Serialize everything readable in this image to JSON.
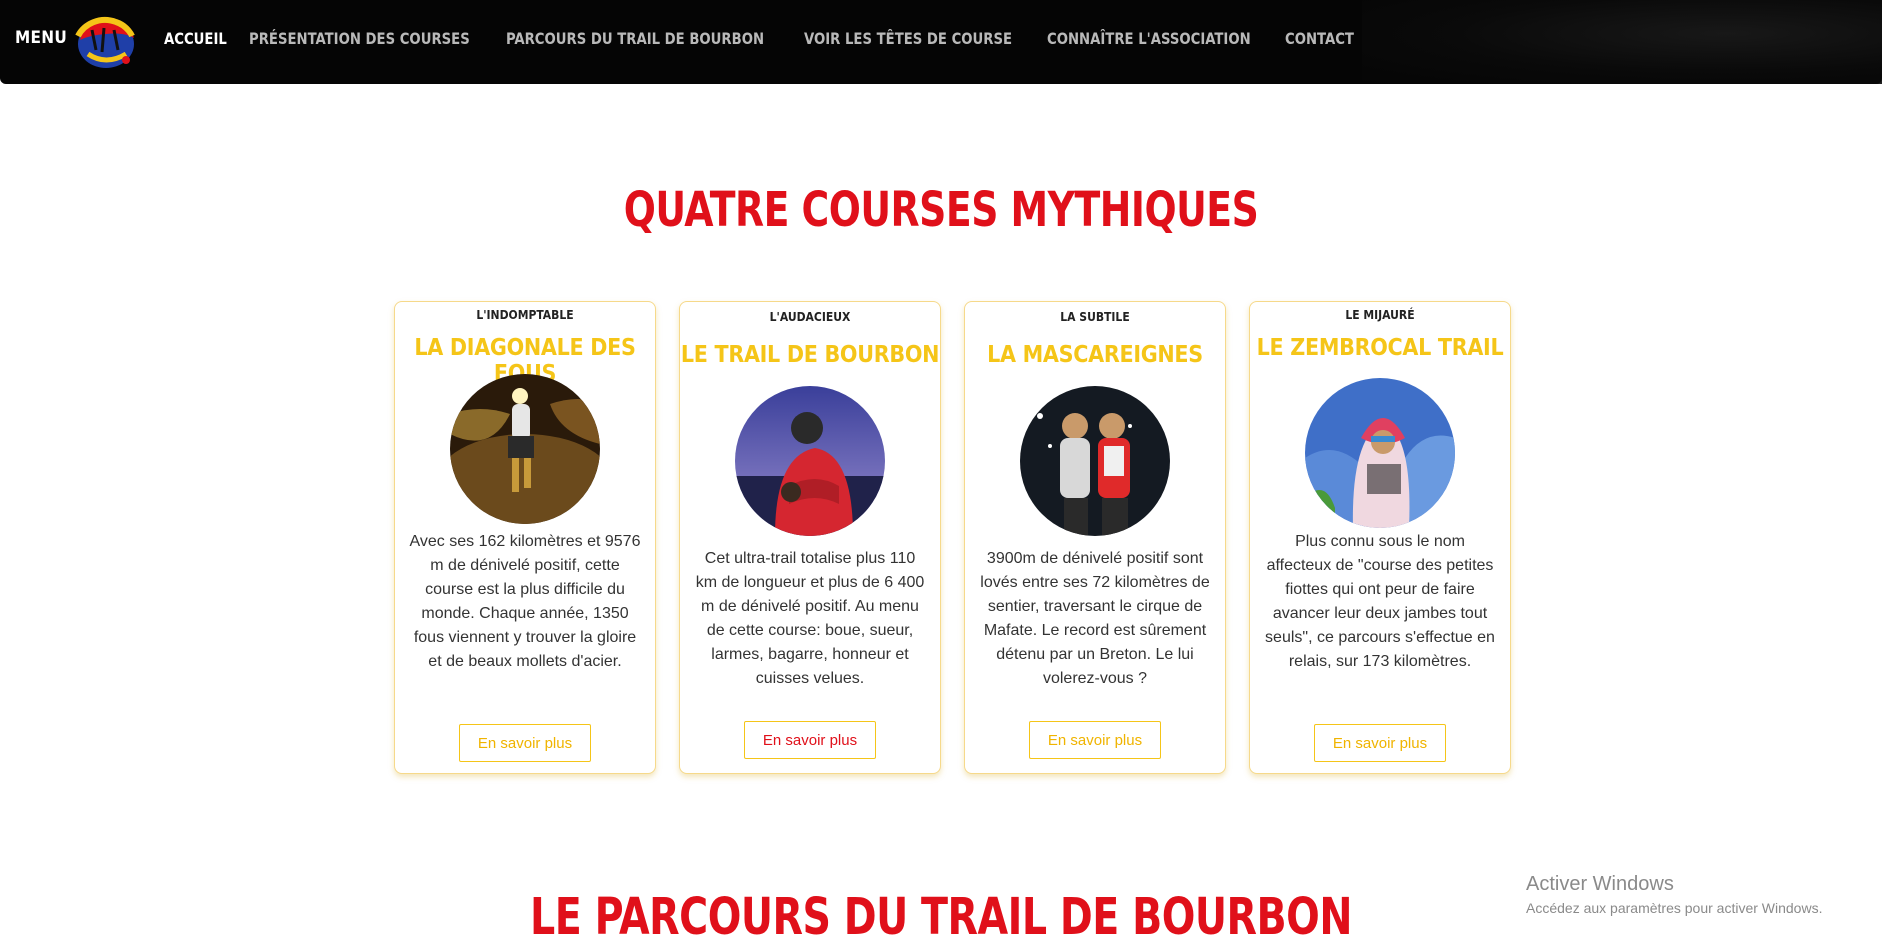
{
  "navbar": {
    "menu_label": "MENU",
    "links": [
      {
        "label": "ACCUEIL",
        "active": true
      },
      {
        "label": "PRÉSENTATION DES COURSES",
        "active": false
      },
      {
        "label": "PARCOURS DU TRAIL DE BOURBON",
        "active": false
      },
      {
        "label": "VOIR LES TÊTES DE COURSE",
        "active": false
      },
      {
        "label": "CONNAÎTRE L'ASSOCIATION",
        "active": false
      },
      {
        "label": "CONTACT",
        "active": false
      }
    ]
  },
  "section1": {
    "title": "QUATRE COURSES MYTHIQUES"
  },
  "cards": [
    {
      "kicker": "L'INDOMPTABLE",
      "name": "LA DIAGONALE DES FOUS",
      "desc": "Avec ses 162 kilomètres et 9576 m de dénivelé positif, cette course est la plus difficile du monde. Chaque année, 1350 fous viennent y trouver la gloire et de beaux mollets d'acier.",
      "button": "En savoir plus",
      "photo_icon": "night-trail-runner-photo"
    },
    {
      "kicker": "L'AUDACIEUX",
      "name": "LE TRAIL DE BOURBON",
      "desc": "Cet ultra-trail totalise plus 110 km de longueur et plus de 6 400 m de dénivelé positif. Au menu de cette course: boue, sueur, larmes, bagarre, honneur et cuisses velues.",
      "button": "En savoir plus",
      "photo_icon": "runners-hug-photo"
    },
    {
      "kicker": "LA SUBTILE",
      "name": "LA MASCAREIGNES",
      "desc": "3900m de dénivelé positif sont lovés entre ses 72 kilomètres de sentier, traversant le cirque de Mafate. Le record est sûrement détenu par un Breton. Le lui volerez-vous ?",
      "button": "En savoir plus",
      "photo_icon": "two-runners-photo"
    },
    {
      "kicker": "LE MIJAURÉ",
      "name": "LE ZEMBROCAL TRAIL",
      "desc": "Plus connu sous le nom affecteux de \"course des petites fiottes qui ont peur de faire avancer leur deux jambes tout seuls\", ce parcours s'effectue en relais, sur 173 kilomètres.",
      "button": "En savoir plus",
      "photo_icon": "hooded-runner-photo"
    }
  ],
  "section2": {
    "title": "LE PARCOURS DU TRAIL DE BOURBON"
  },
  "windows_watermark": {
    "line1": "Activer Windows",
    "line2": "Accédez aux paramètres pour activer Windows."
  },
  "colors": {
    "title_red": "#e0101a",
    "card_yellow": "#f5c518",
    "nav_bg": "#050505"
  }
}
